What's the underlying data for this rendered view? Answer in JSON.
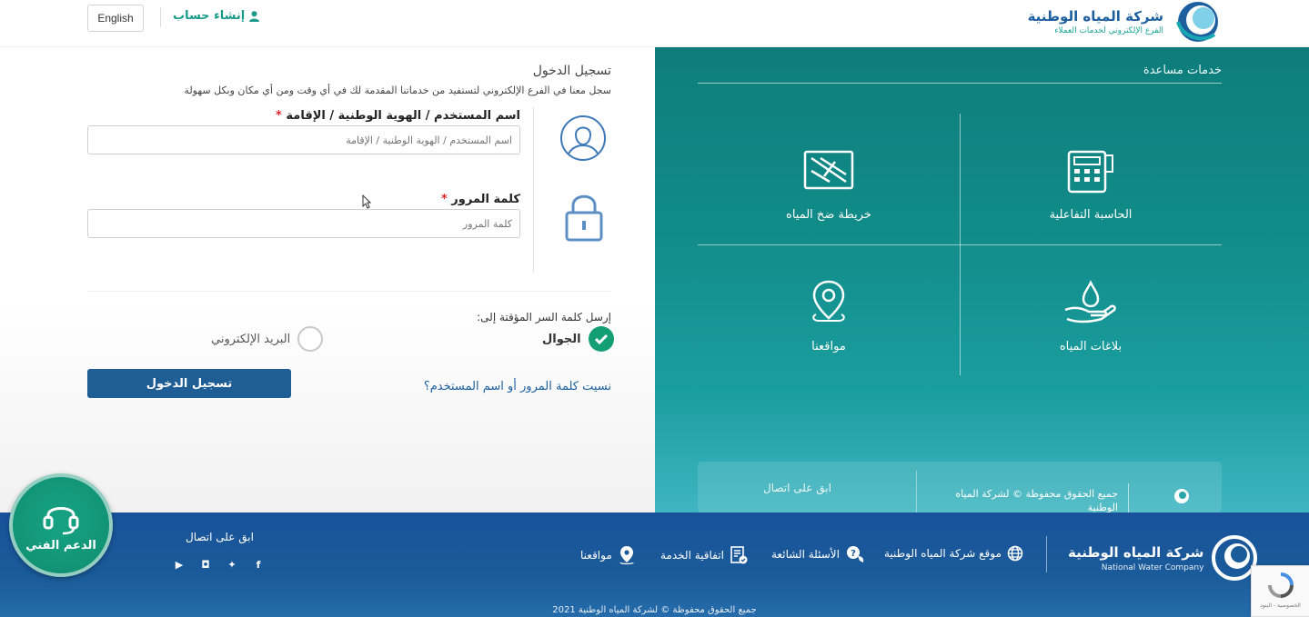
{
  "header": {
    "lang_button": "English",
    "create_account": "إنشاء حساب",
    "logo_title": "شركة المياه الوطنية",
    "logo_subtitle": "الفرع الإلكتروني لخدمات العملاء"
  },
  "login": {
    "title": "تسجيل الدخول",
    "subtitle": "سجل معنا في الفرع الإلكتروني لتستفيد من خدماتنا المقدمة لك في أي وقت ومن أي مكان وبكل سهولة",
    "username_label": "اسم المستخدم / الهوية الوطنية / الإقامة",
    "username_placeholder": "اسم المستخدم / الهوية الوطنية / الإقامة",
    "password_label": "كلمة المرور",
    "password_placeholder": "كلمة المرور",
    "required_mark": "*",
    "send_otp_label": "إرسل كلمة السر المؤقتة إلى:",
    "option_mobile": "الجوال",
    "option_email": "البريد الإلكتروني",
    "selected_option": "الجوال",
    "submit_button": "تسجيل الدخول",
    "forgot_link": "نسيت كلمة المرور أو اسم المستخدم؟"
  },
  "services": {
    "title": "خدمات مساعدة",
    "items": [
      {
        "label": "الحاسبة التفاعلية",
        "icon": "calculator-icon"
      },
      {
        "label": "خريطة ضخ المياه",
        "icon": "map-icon"
      },
      {
        "label": "بلاغات المياه",
        "icon": "water-hand-icon"
      },
      {
        "label": "مواقعنا",
        "icon": "location-pin-icon"
      }
    ],
    "card_follow": "ابق على اتصال",
    "card_copyright": "جميع الحقوق محفوظة © لشركة المياه الوطنية"
  },
  "footer": {
    "logo_title": "شركة المياه الوطنية",
    "logo_subtitle": "National Water Company",
    "links": [
      {
        "label": "موقع شركة المياه الوطنية",
        "icon": "globe-icon"
      },
      {
        "label": "الأسئلة الشائعة",
        "icon": "faq-icon"
      },
      {
        "label": "اتفاقية الخدمة",
        "icon": "agreement-icon"
      },
      {
        "label": "مواقعنا",
        "icon": "location-pin-icon"
      }
    ],
    "follow_label": "ابق على اتصال",
    "copyright": "جميع الحقوق محفوظة © لشركة المياه الوطنية 2021"
  },
  "support": {
    "label": "الدعم الفني"
  },
  "recaptcha": {
    "text": "الخصوصية - البنود"
  },
  "colors": {
    "teal": "#118c89",
    "footer_blue": "#1a5b9a",
    "button_blue": "#1e5e95",
    "accent_green": "#139e73",
    "required_red": "#d9252b"
  }
}
